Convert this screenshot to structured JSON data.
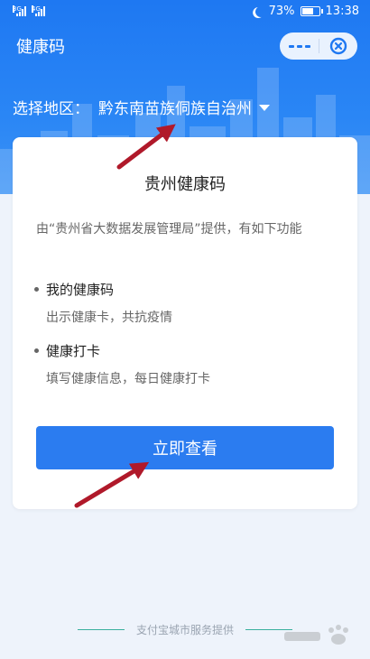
{
  "status_bar": {
    "sig1_label": "3G",
    "sig2_label": "4G",
    "battery_pct": "73%",
    "battery_level": 0.73,
    "time": "13:38"
  },
  "header": {
    "title": "健康码"
  },
  "region": {
    "label": "选择地区：",
    "value": "黔东南苗族侗族自治州"
  },
  "card": {
    "title": "贵州健康码",
    "description": "由“贵州省大数据发展管理局”提供，有如下功能",
    "features": [
      {
        "title": "我的健康码",
        "subtitle": "出示健康卡，共抗疫情"
      },
      {
        "title": "健康打卡",
        "subtitle": "填写健康信息，每日健康打卡"
      }
    ],
    "button_label": "立即查看"
  },
  "footer": {
    "text": "支付宝城市服务提供"
  },
  "colors": {
    "primary": "#2b7cf0",
    "header_bg": "#1e78f2",
    "arrow": "#b0192a",
    "footer_line": "#3ab09e"
  }
}
